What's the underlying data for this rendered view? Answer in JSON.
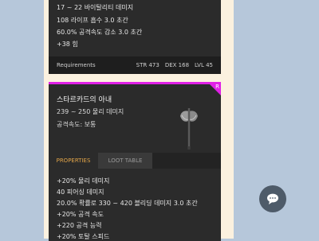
{
  "top_item": {
    "stats": [
      "17 ~ 22 바이탈리티 데미지",
      "108 라이프 흡수 3.0 초간",
      "60.0% 공격속도 감소 3.0 초간",
      "+38 힘"
    ],
    "requirements_label": "Requirements",
    "requirements": {
      "str": "STR 473",
      "dex": "DEX 168",
      "lvl": "LVL 45"
    }
  },
  "item": {
    "rarity_letter": "R",
    "rarity_color": "#e020e6",
    "name": "스타르카드의 아내",
    "damage": "239 ~ 250 물리 데미지",
    "attack_speed": "공격속도: 보통",
    "icon": "axe-icon"
  },
  "tabs": {
    "properties": "PROPERTIES",
    "loot_table": "LOOT TABLE",
    "active": "properties"
  },
  "properties": [
    "+20% 물리 데미지",
    "40 피어싱 데미지",
    "20.0% 확률로 330 ~ 420 블리딩 데미지 3.0 초간",
    "+20% 공격 속도",
    "+220 공격 능력",
    "+20% 토탈 스피드"
  ],
  "chat_button": {
    "icon": "chat-bubble-icon"
  }
}
